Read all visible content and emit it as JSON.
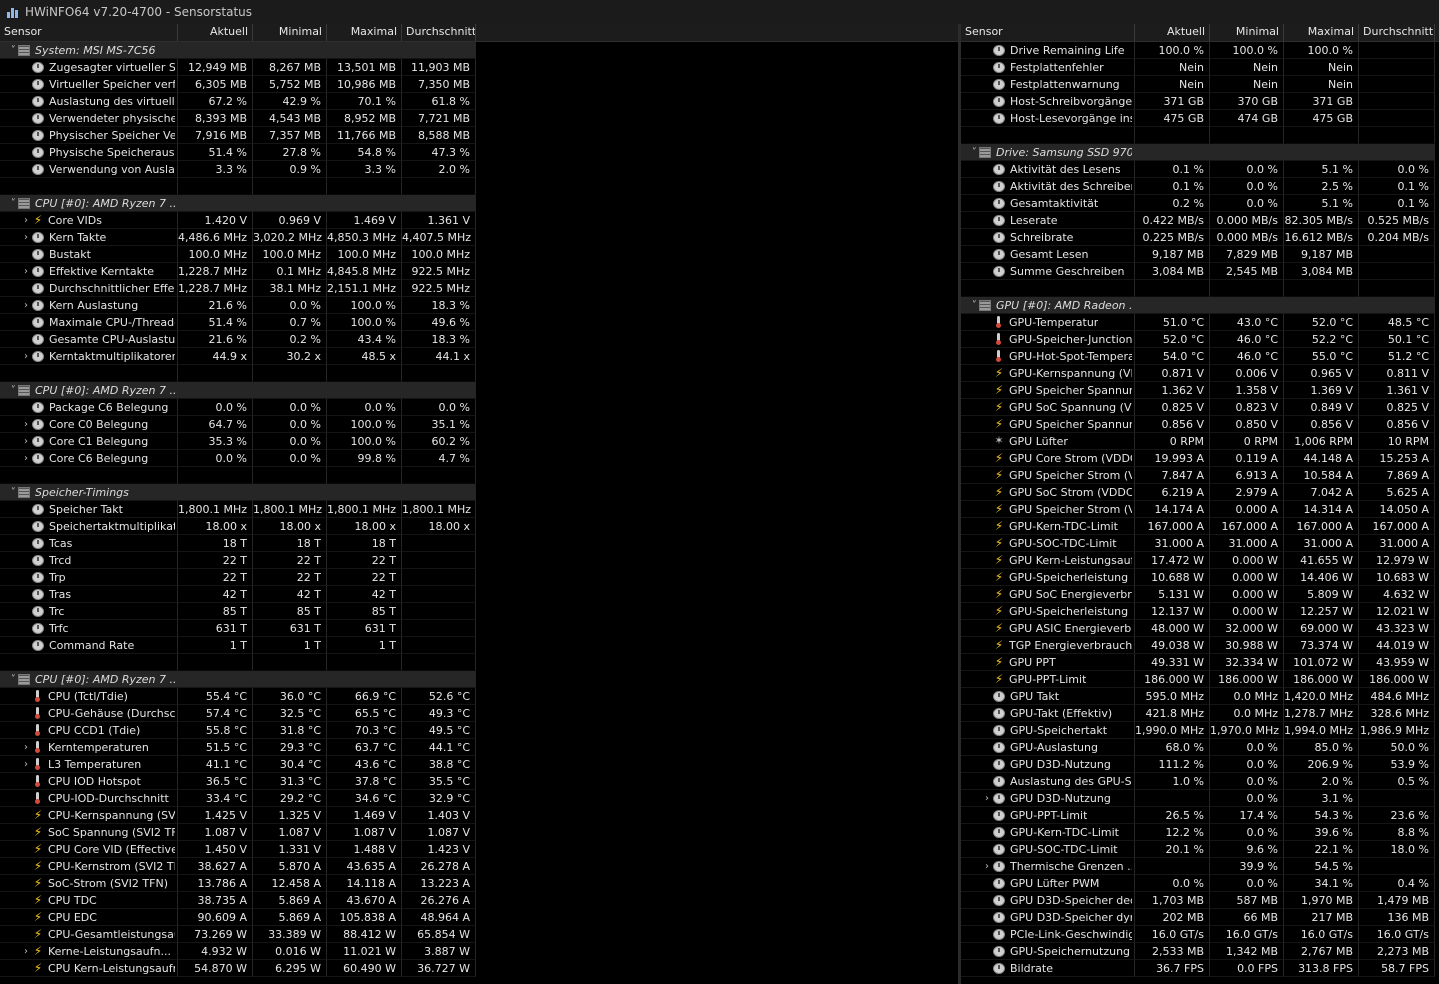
{
  "window": {
    "title": "HWiNFO64 v7.20-4700 - Sensorstatus"
  },
  "columns": [
    "Sensor",
    "Aktuell",
    "Minimal",
    "Maximal",
    "Durchschnitt"
  ],
  "left_rows": [
    {
      "t": "g",
      "name": "System: MSI MS-7C56"
    },
    {
      "name": "Zugesagter virtueller Sp...",
      "icon": "clock",
      "level": 1,
      "v": [
        "12,949 MB",
        "8,267 MB",
        "13,501 MB",
        "11,903 MB"
      ]
    },
    {
      "name": "Virtueller Speicher verfü...",
      "icon": "clock",
      "level": 1,
      "v": [
        "6,305 MB",
        "5,752 MB",
        "10,986 MB",
        "7,350 MB"
      ]
    },
    {
      "name": "Auslastung des virtuelle...",
      "icon": "clock",
      "level": 1,
      "v": [
        "67.2 %",
        "42.9 %",
        "70.1 %",
        "61.8 %"
      ]
    },
    {
      "name": "Verwendeter physischer ...",
      "icon": "clock",
      "level": 1,
      "v": [
        "8,393 MB",
        "4,543 MB",
        "8,952 MB",
        "7,721 MB"
      ]
    },
    {
      "name": "Physischer Speicher Verf...",
      "icon": "clock",
      "level": 1,
      "v": [
        "7,916 MB",
        "7,357 MB",
        "11,766 MB",
        "8,588 MB"
      ]
    },
    {
      "name": "Physische Speicherausla...",
      "icon": "clock",
      "level": 1,
      "v": [
        "51.4 %",
        "27.8 %",
        "54.8 %",
        "47.3 %"
      ]
    },
    {
      "name": "Verwendung von Auslag...",
      "icon": "clock",
      "level": 1,
      "v": [
        "3.3 %",
        "0.9 %",
        "3.3 %",
        "2.0 %"
      ]
    },
    {
      "t": "b"
    },
    {
      "t": "g",
      "name": "CPU [#0]: AMD Ryzen 7 ..."
    },
    {
      "name": "Core VIDs",
      "icon": "bolt",
      "level": 2,
      "v": [
        "1.420 V",
        "0.969 V",
        "1.469 V",
        "1.361 V"
      ]
    },
    {
      "name": "Kern Takte",
      "icon": "clock",
      "level": 2,
      "v": [
        "4,486.6 MHz",
        "3,020.2 MHz",
        "4,850.3 MHz",
        "4,407.5 MHz"
      ]
    },
    {
      "name": "Bustakt",
      "icon": "clock",
      "level": 1,
      "v": [
        "100.0 MHz",
        "100.0 MHz",
        "100.0 MHz",
        "100.0 MHz"
      ]
    },
    {
      "name": "Effektive Kerntakte",
      "icon": "clock",
      "level": 2,
      "v": [
        "1,228.7 MHz",
        "0.1 MHz",
        "4,845.8 MHz",
        "922.5 MHz"
      ]
    },
    {
      "name": "Durchschnittlicher Effekti...",
      "icon": "clock",
      "level": 1,
      "v": [
        "1,228.7 MHz",
        "38.1 MHz",
        "2,151.1 MHz",
        "922.5 MHz"
      ]
    },
    {
      "name": "Kern Auslastung",
      "icon": "clock",
      "level": 2,
      "v": [
        "21.6 %",
        "0.0 %",
        "100.0 %",
        "18.3 %"
      ]
    },
    {
      "name": "Maximale CPU-/Thread-...",
      "icon": "clock",
      "level": 1,
      "v": [
        "51.4 %",
        "0.7 %",
        "100.0 %",
        "49.6 %"
      ]
    },
    {
      "name": "Gesamte CPU-Auslastung",
      "icon": "clock",
      "level": 1,
      "v": [
        "21.6 %",
        "0.2 %",
        "43.4 %",
        "18.3 %"
      ]
    },
    {
      "name": "Kerntaktmultiplikatoren",
      "icon": "clock",
      "level": 2,
      "v": [
        "44.9 x",
        "30.2 x",
        "48.5 x",
        "44.1 x"
      ]
    },
    {
      "t": "b"
    },
    {
      "t": "g",
      "name": "CPU [#0]: AMD Ryzen 7 ..."
    },
    {
      "name": "Package C6 Belegung",
      "icon": "clock",
      "level": 1,
      "v": [
        "0.0 %",
        "0.0 %",
        "0.0 %",
        "0.0 %"
      ]
    },
    {
      "name": "Core C0 Belegung",
      "icon": "clock",
      "level": 2,
      "v": [
        "64.7 %",
        "0.0 %",
        "100.0 %",
        "35.1 %"
      ]
    },
    {
      "name": "Core C1 Belegung",
      "icon": "clock",
      "level": 2,
      "v": [
        "35.3 %",
        "0.0 %",
        "100.0 %",
        "60.2 %"
      ]
    },
    {
      "name": "Core C6 Belegung",
      "icon": "clock",
      "level": 2,
      "v": [
        "0.0 %",
        "0.0 %",
        "99.8 %",
        "4.7 %"
      ]
    },
    {
      "t": "b"
    },
    {
      "t": "g",
      "name": "Speicher-Timings"
    },
    {
      "name": "Speicher Takt",
      "icon": "clock",
      "level": 1,
      "v": [
        "1,800.1 MHz",
        "1,800.1 MHz",
        "1,800.1 MHz",
        "1,800.1 MHz"
      ]
    },
    {
      "name": "Speichertaktmultiplikator",
      "icon": "clock",
      "level": 1,
      "v": [
        "18.00 x",
        "18.00 x",
        "18.00 x",
        "18.00 x"
      ]
    },
    {
      "name": "Tcas",
      "icon": "clock",
      "level": 1,
      "v": [
        "18 T",
        "18 T",
        "18 T",
        ""
      ]
    },
    {
      "name": "Trcd",
      "icon": "clock",
      "level": 1,
      "v": [
        "22 T",
        "22 T",
        "22 T",
        ""
      ]
    },
    {
      "name": "Trp",
      "icon": "clock",
      "level": 1,
      "v": [
        "22 T",
        "22 T",
        "22 T",
        ""
      ]
    },
    {
      "name": "Tras",
      "icon": "clock",
      "level": 1,
      "v": [
        "42 T",
        "42 T",
        "42 T",
        ""
      ]
    },
    {
      "name": "Trc",
      "icon": "clock",
      "level": 1,
      "v": [
        "85 T",
        "85 T",
        "85 T",
        ""
      ]
    },
    {
      "name": "Trfc",
      "icon": "clock",
      "level": 1,
      "v": [
        "631 T",
        "631 T",
        "631 T",
        ""
      ]
    },
    {
      "name": "Command Rate",
      "icon": "clock",
      "level": 1,
      "v": [
        "1 T",
        "1 T",
        "1 T",
        ""
      ]
    },
    {
      "t": "b"
    },
    {
      "t": "g",
      "name": "CPU [#0]: AMD Ryzen 7 ..."
    },
    {
      "name": "CPU (Tctl/Tdie)",
      "icon": "therm",
      "level": 1,
      "v": [
        "55.4 °C",
        "36.0 °C",
        "66.9 °C",
        "52.6 °C"
      ]
    },
    {
      "name": "CPU-Gehäuse (Durchsch...",
      "icon": "therm",
      "level": 1,
      "v": [
        "57.4 °C",
        "32.5 °C",
        "65.5 °C",
        "49.3 °C"
      ]
    },
    {
      "name": "CPU CCD1 (Tdie)",
      "icon": "therm",
      "level": 1,
      "v": [
        "55.8 °C",
        "31.8 °C",
        "70.3 °C",
        "49.5 °C"
      ]
    },
    {
      "name": "Kerntemperaturen",
      "icon": "therm",
      "level": 2,
      "v": [
        "51.5 °C",
        "29.3 °C",
        "63.7 °C",
        "44.1 °C"
      ]
    },
    {
      "name": "L3 Temperaturen",
      "icon": "therm",
      "level": 2,
      "v": [
        "41.1 °C",
        "30.4 °C",
        "43.6 °C",
        "38.8 °C"
      ]
    },
    {
      "name": "CPU IOD Hotspot",
      "icon": "therm",
      "level": 1,
      "v": [
        "36.5 °C",
        "31.3 °C",
        "37.8 °C",
        "35.5 °C"
      ]
    },
    {
      "name": "CPU-IOD-Durchschnitt",
      "icon": "therm",
      "level": 1,
      "v": [
        "33.4 °C",
        "29.2 °C",
        "34.6 °C",
        "32.9 °C"
      ]
    },
    {
      "name": "CPU-Kernspannung (SVI...",
      "icon": "bolt",
      "level": 1,
      "v": [
        "1.425 V",
        "1.325 V",
        "1.469 V",
        "1.403 V"
      ]
    },
    {
      "name": "SoC Spannung (SVI2 TFN)",
      "icon": "bolt",
      "level": 1,
      "v": [
        "1.087 V",
        "1.087 V",
        "1.087 V",
        "1.087 V"
      ]
    },
    {
      "name": "CPU Core VID (Effective)",
      "icon": "bolt",
      "level": 1,
      "v": [
        "1.450 V",
        "1.331 V",
        "1.488 V",
        "1.423 V"
      ]
    },
    {
      "name": "CPU-Kernstrom (SVI2 TFN)",
      "icon": "bolt",
      "level": 1,
      "v": [
        "38.627 A",
        "5.870 A",
        "43.635 A",
        "26.278 A"
      ]
    },
    {
      "name": "SoC-Strom (SVI2 TFN)",
      "icon": "bolt",
      "level": 1,
      "v": [
        "13.786 A",
        "12.458 A",
        "14.118 A",
        "13.223 A"
      ]
    },
    {
      "name": "CPU TDC",
      "icon": "bolt",
      "level": 1,
      "v": [
        "38.735 A",
        "5.869 A",
        "43.670 A",
        "26.276 A"
      ]
    },
    {
      "name": "CPU EDC",
      "icon": "bolt",
      "level": 1,
      "v": [
        "90.609 A",
        "5.869 A",
        "105.838 A",
        "48.964 A"
      ]
    },
    {
      "name": "CPU-Gesamtleistungsauf...",
      "icon": "bolt",
      "level": 1,
      "v": [
        "73.269 W",
        "33.389 W",
        "88.412 W",
        "65.854 W"
      ]
    },
    {
      "name": "Kerne-Leistungsaufn...",
      "icon": "bolt",
      "level": 2,
      "v": [
        "4.932 W",
        "0.016 W",
        "11.021 W",
        "3.887 W"
      ]
    },
    {
      "name": "CPU Kern-Leistungsaufn...",
      "icon": "bolt",
      "level": 1,
      "v": [
        "54.870 W",
        "6.295 W",
        "60.490 W",
        "36.727 W"
      ]
    }
  ],
  "right_rows": [
    {
      "name": "Drive Remaining Life",
      "icon": "clock",
      "level": 1,
      "v": [
        "100.0 %",
        "100.0 %",
        "100.0 %",
        ""
      ]
    },
    {
      "name": "Festplattenfehler",
      "icon": "clock",
      "level": 1,
      "v": [
        "Nein",
        "Nein",
        "Nein",
        ""
      ]
    },
    {
      "name": "Festplattenwarnung",
      "icon": "clock",
      "level": 1,
      "v": [
        "Nein",
        "Nein",
        "Nein",
        ""
      ]
    },
    {
      "name": "Host-Schreibvorgänge in...",
      "icon": "clock",
      "level": 1,
      "v": [
        "371 GB",
        "370 GB",
        "371 GB",
        ""
      ]
    },
    {
      "name": "Host-Lesevorgänge insg...",
      "icon": "clock",
      "level": 1,
      "v": [
        "475 GB",
        "474 GB",
        "475 GB",
        ""
      ]
    },
    {
      "t": "b"
    },
    {
      "t": "g",
      "name": "Drive: Samsung SSD 970..."
    },
    {
      "name": "Aktivität des Lesens",
      "icon": "clock",
      "level": 1,
      "v": [
        "0.1 %",
        "0.0 %",
        "5.1 %",
        "0.0 %"
      ]
    },
    {
      "name": "Aktivität des Schreibens",
      "icon": "clock",
      "level": 1,
      "v": [
        "0.1 %",
        "0.0 %",
        "2.5 %",
        "0.1 %"
      ]
    },
    {
      "name": "Gesamtaktivität",
      "icon": "clock",
      "level": 1,
      "v": [
        "0.2 %",
        "0.0 %",
        "5.1 %",
        "0.1 %"
      ]
    },
    {
      "name": "Leserate",
      "icon": "clock",
      "level": 1,
      "v": [
        "0.422 MB/s",
        "0.000 MB/s",
        "82.305 MB/s",
        "0.525 MB/s"
      ]
    },
    {
      "name": "Schreibrate",
      "icon": "clock",
      "level": 1,
      "v": [
        "0.225 MB/s",
        "0.000 MB/s",
        "16.612 MB/s",
        "0.204 MB/s"
      ]
    },
    {
      "name": "Gesamt Lesen",
      "icon": "clock",
      "level": 1,
      "v": [
        "9,187 MB",
        "7,829 MB",
        "9,187 MB",
        ""
      ]
    },
    {
      "name": "Summe Geschreiben",
      "icon": "clock",
      "level": 1,
      "v": [
        "3,084 MB",
        "2,545 MB",
        "3,084 MB",
        ""
      ]
    },
    {
      "t": "b"
    },
    {
      "t": "g",
      "name": "GPU [#0]: AMD Radeon ..."
    },
    {
      "name": "GPU-Temperatur",
      "icon": "therm",
      "level": 1,
      "v": [
        "51.0 °C",
        "43.0 °C",
        "52.0 °C",
        "48.5 °C"
      ]
    },
    {
      "name": "GPU-Speicher-Junction-T...",
      "icon": "therm",
      "level": 1,
      "v": [
        "52.0 °C",
        "46.0 °C",
        "52.2 °C",
        "50.1 °C"
      ]
    },
    {
      "name": "GPU-Hot-Spot-Temperatur",
      "icon": "therm",
      "level": 1,
      "v": [
        "54.0 °C",
        "46.0 °C",
        "55.0 °C",
        "51.2 °C"
      ]
    },
    {
      "name": "GPU-Kernspannung (VD...",
      "icon": "bolt",
      "level": 1,
      "v": [
        "0.871 V",
        "0.006 V",
        "0.965 V",
        "0.811 V"
      ]
    },
    {
      "name": "GPU Speicher Spannung ...",
      "icon": "bolt",
      "level": 1,
      "v": [
        "1.362 V",
        "1.358 V",
        "1.369 V",
        "1.361 V"
      ]
    },
    {
      "name": "GPU SoC Spannung (VD...",
      "icon": "bolt",
      "level": 1,
      "v": [
        "0.825 V",
        "0.823 V",
        "0.849 V",
        "0.825 V"
      ]
    },
    {
      "name": "GPU Speicher Spannung ...",
      "icon": "bolt",
      "level": 1,
      "v": [
        "0.856 V",
        "0.850 V",
        "0.856 V",
        "0.856 V"
      ]
    },
    {
      "name": "GPU Lüfter",
      "icon": "fan",
      "level": 1,
      "v": [
        "0 RPM",
        "0 RPM",
        "1,006 RPM",
        "10 RPM"
      ]
    },
    {
      "name": "GPU Core Strom (VDDCR...",
      "icon": "bolt",
      "level": 1,
      "v": [
        "19.993 A",
        "0.119 A",
        "44.148 A",
        "15.253 A"
      ]
    },
    {
      "name": "GPU Speicher Strom (VD...",
      "icon": "bolt",
      "level": 1,
      "v": [
        "7.847 A",
        "6.913 A",
        "10.584 A",
        "7.869 A"
      ]
    },
    {
      "name": "GPU SoC Strom (VDDCR...",
      "icon": "bolt",
      "level": 1,
      "v": [
        "6.219 A",
        "2.979 A",
        "7.042 A",
        "5.625 A"
      ]
    },
    {
      "name": "GPU Speicher Strom (VD...",
      "icon": "bolt",
      "level": 1,
      "v": [
        "14.174 A",
        "0.000 A",
        "14.314 A",
        "14.050 A"
      ]
    },
    {
      "name": "GPU-Kern-TDC-Limit",
      "icon": "bolt",
      "level": 1,
      "v": [
        "167.000 A",
        "167.000 A",
        "167.000 A",
        "167.000 A"
      ]
    },
    {
      "name": "GPU-SOC-TDC-Limit",
      "icon": "bolt",
      "level": 1,
      "v": [
        "31.000 A",
        "31.000 A",
        "31.000 A",
        "31.000 A"
      ]
    },
    {
      "name": "GPU Kern-Leistungsaufn...",
      "icon": "bolt",
      "level": 1,
      "v": [
        "17.472 W",
        "0.000 W",
        "41.655 W",
        "12.979 W"
      ]
    },
    {
      "name": "GPU-Speicherleistung (V...",
      "icon": "bolt",
      "level": 1,
      "v": [
        "10.688 W",
        "0.000 W",
        "14.406 W",
        "10.683 W"
      ]
    },
    {
      "name": "GPU SoC Energieverbrau...",
      "icon": "bolt",
      "level": 1,
      "v": [
        "5.131 W",
        "0.000 W",
        "5.809 W",
        "4.632 W"
      ]
    },
    {
      "name": "GPU-Speicherleistung (V...",
      "icon": "bolt",
      "level": 1,
      "v": [
        "12.137 W",
        "0.000 W",
        "12.257 W",
        "12.021 W"
      ]
    },
    {
      "name": "GPU ASIC Energieverbra...",
      "icon": "bolt",
      "level": 1,
      "v": [
        "48.000 W",
        "32.000 W",
        "69.000 W",
        "43.323 W"
      ]
    },
    {
      "name": "TGP Energieverbrauch",
      "icon": "bolt",
      "level": 1,
      "v": [
        "49.038 W",
        "30.988 W",
        "73.374 W",
        "44.019 W"
      ]
    },
    {
      "name": "GPU PPT",
      "icon": "bolt",
      "level": 1,
      "v": [
        "49.331 W",
        "32.334 W",
        "101.072 W",
        "43.959 W"
      ]
    },
    {
      "name": "GPU-PPT-Limit",
      "icon": "bolt",
      "level": 1,
      "v": [
        "186.000 W",
        "186.000 W",
        "186.000 W",
        "186.000 W"
      ]
    },
    {
      "name": "GPU Takt",
      "icon": "clock",
      "level": 1,
      "v": [
        "595.0 MHz",
        "0.0 MHz",
        "1,420.0 MHz",
        "484.6 MHz"
      ]
    },
    {
      "name": "GPU-Takt (Effektiv)",
      "icon": "clock",
      "level": 1,
      "v": [
        "421.8 MHz",
        "0.0 MHz",
        "1,278.7 MHz",
        "328.6 MHz"
      ]
    },
    {
      "name": "GPU-Speichertakt",
      "icon": "clock",
      "level": 1,
      "v": [
        "1,990.0 MHz",
        "1,970.0 MHz",
        "1,994.0 MHz",
        "1,986.9 MHz"
      ]
    },
    {
      "name": "GPU-Auslastung",
      "icon": "clock",
      "level": 1,
      "v": [
        "68.0 %",
        "0.0 %",
        "85.0 %",
        "50.0 %"
      ]
    },
    {
      "name": "GPU D3D-Nutzung",
      "icon": "clock",
      "level": 1,
      "v": [
        "111.2 %",
        "0.0 %",
        "206.9 %",
        "53.9 %"
      ]
    },
    {
      "name": "Auslastung des GPU-Spe...",
      "icon": "clock",
      "level": 1,
      "v": [
        "1.0 %",
        "0.0 %",
        "2.0 %",
        "0.5 %"
      ]
    },
    {
      "name": "GPU D3D-Nutzung",
      "icon": "clock",
      "level": 2,
      "v": [
        "",
        "0.0 %",
        "3.1 %",
        ""
      ]
    },
    {
      "name": "GPU-PPT-Limit",
      "icon": "clock",
      "level": 1,
      "v": [
        "26.5 %",
        "17.4 %",
        "54.3 %",
        "23.6 %"
      ]
    },
    {
      "name": "GPU-Kern-TDC-Limit",
      "icon": "clock",
      "level": 1,
      "v": [
        "12.2 %",
        "0.0 %",
        "39.6 %",
        "8.8 %"
      ]
    },
    {
      "name": "GPU-SOC-TDC-Limit",
      "icon": "clock",
      "level": 1,
      "v": [
        "20.1 %",
        "9.6 %",
        "22.1 %",
        "18.0 %"
      ]
    },
    {
      "name": "Thermische Grenzen ...",
      "icon": "clock",
      "level": 2,
      "v": [
        "",
        "39.9 %",
        "54.5 %",
        ""
      ]
    },
    {
      "name": "GPU Lüfter PWM",
      "icon": "clock",
      "level": 1,
      "v": [
        "0.0 %",
        "0.0 %",
        "34.1 %",
        "0.4 %"
      ]
    },
    {
      "name": "GPU D3D-Speicher dedizi...",
      "icon": "clock",
      "level": 1,
      "v": [
        "1,703 MB",
        "587 MB",
        "1,970 MB",
        "1,479 MB"
      ]
    },
    {
      "name": "GPU D3D-Speicher dyna...",
      "icon": "clock",
      "level": 1,
      "v": [
        "202 MB",
        "66 MB",
        "217 MB",
        "136 MB"
      ]
    },
    {
      "name": "PCIe-Link-Geschwindigkeit",
      "icon": "clock",
      "level": 1,
      "v": [
        "16.0 GT/s",
        "16.0 GT/s",
        "16.0 GT/s",
        "16.0 GT/s"
      ]
    },
    {
      "name": "GPU-Speichernutzung",
      "icon": "clock",
      "level": 1,
      "v": [
        "2,533 MB",
        "1,342 MB",
        "2,767 MB",
        "2,273 MB"
      ]
    },
    {
      "name": "Bildrate",
      "icon": "clock",
      "level": 1,
      "v": [
        "36.7 FPS",
        "0.0 FPS",
        "313.8 FPS",
        "58.7 FPS"
      ]
    }
  ]
}
